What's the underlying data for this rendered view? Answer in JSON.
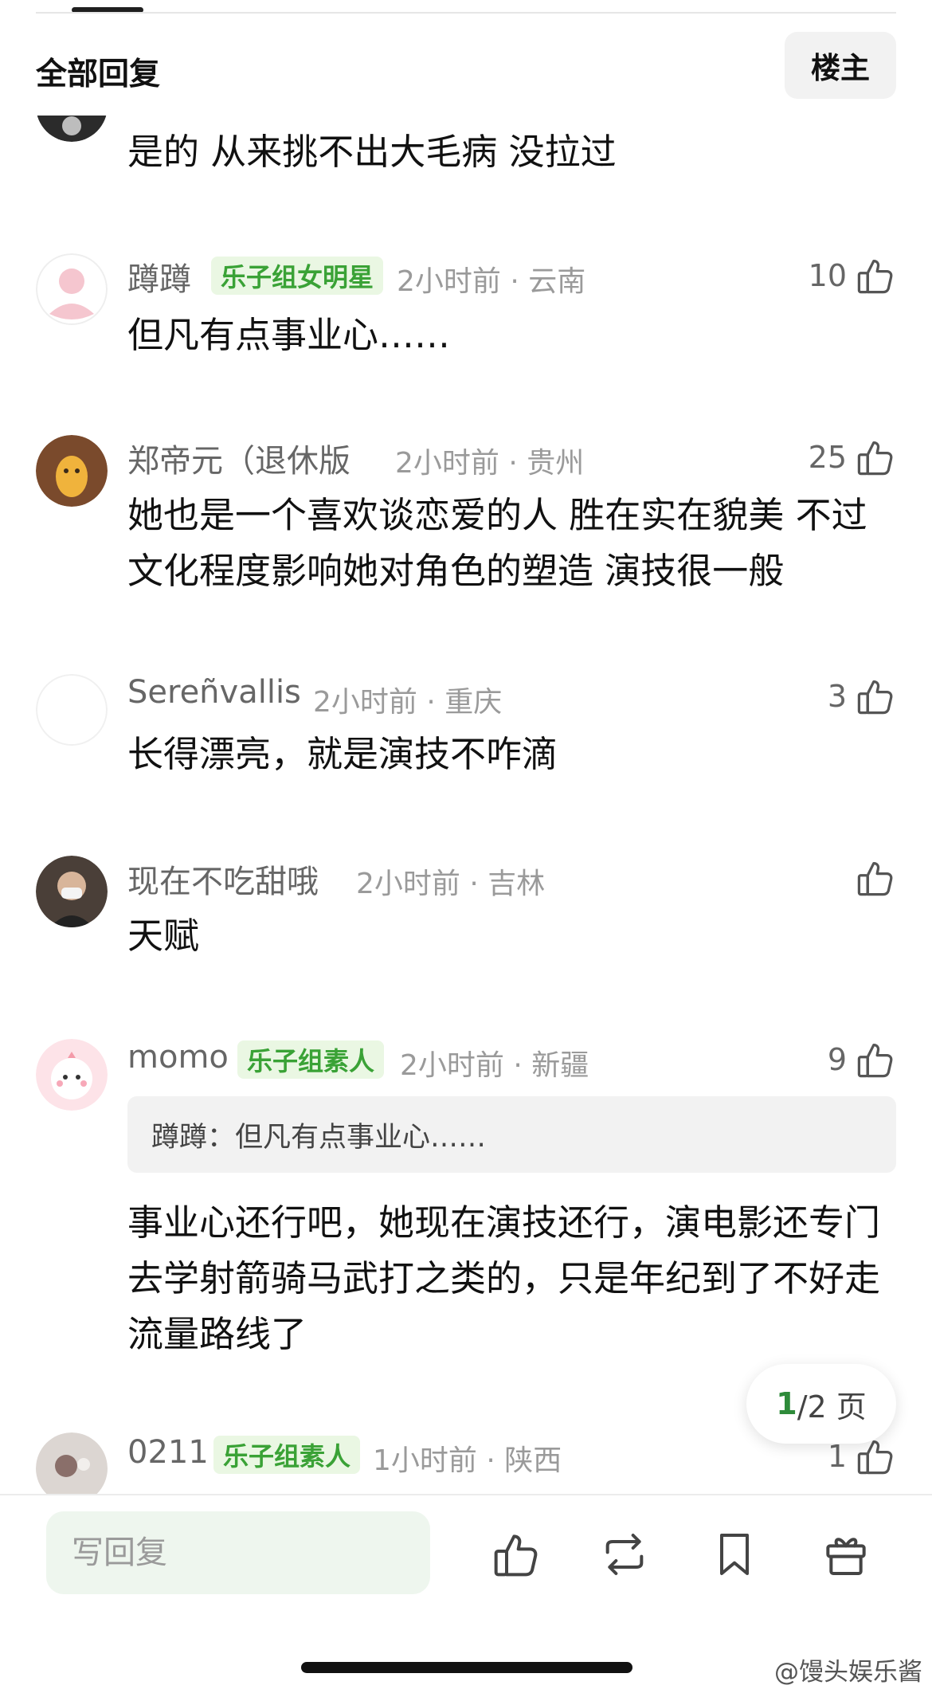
{
  "header": {
    "title": "全部回复",
    "owner_label": "楼主"
  },
  "comments": [
    {
      "text": "是的 从来挑不出大毛病 没拉过"
    },
    {
      "user": "蹲蹲",
      "badge": "乐子组女明星",
      "time": "2小时前",
      "location": "云南",
      "likes": "10",
      "text": "但凡有点事业心……"
    },
    {
      "user": "郑帝元（退休版",
      "time": "2小时前",
      "location": "贵州",
      "likes": "25",
      "text": "她也是一个喜欢谈恋爱的人 胜在实在貌美 不过文化程度影响她对角色的塑造 演技很一般"
    },
    {
      "user": "Sereñvallis",
      "time": "2小时前",
      "location": "重庆",
      "likes": "3",
      "text": "长得漂亮，就是演技不咋滴"
    },
    {
      "user": "现在不吃甜哦",
      "time": "2小时前",
      "location": "吉林",
      "likes": "",
      "text": "天赋"
    },
    {
      "user": "momo",
      "badge": "乐子组素人",
      "time": "2小时前",
      "location": "新疆",
      "likes": "9",
      "quote": "蹲蹲：但凡有点事业心……",
      "text": "事业心还行吧，她现在演技还行，演电影还专门去学射箭骑马武打之类的，只是年纪到了不好走流量路线了"
    },
    {
      "user": "0211",
      "badge": "乐子组素人",
      "time": "1小时前",
      "location": "陕西",
      "likes": "1"
    }
  ],
  "pagination": {
    "current": "1",
    "total_text": "/2 页"
  },
  "bottom_bar": {
    "reply_placeholder": "写回复"
  },
  "watermark": "@馒头娱乐酱",
  "icons": [
    "like-icon",
    "repost-icon",
    "bookmark-icon",
    "gift-icon"
  ],
  "colors": {
    "badge_text": "#3aa236",
    "badge_bg": "#eaf7e3",
    "page_current": "#2e8b3a"
  }
}
